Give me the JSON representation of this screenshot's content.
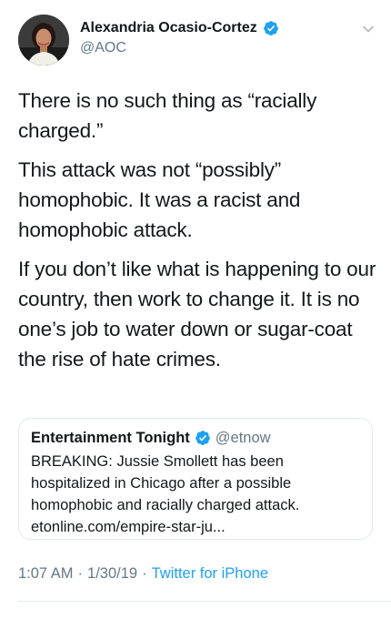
{
  "author": {
    "display_name": "Alexandria Ocasio-Cortez",
    "handle": "@AOC",
    "verified_icon": "verified-badge-icon"
  },
  "menu_icon": "chevron-down-icon",
  "tweet": {
    "paragraphs": [
      "There is no such thing as “racially charged.”",
      "This attack was not “possibly” homophobic. It was a racist and homophobic attack.",
      "If you don’t like what is happening to our country, then work to change it. It is no one’s job to water down or sugar-coat the rise of hate crimes."
    ]
  },
  "quoted_tweet": {
    "display_name": "Entertainment Tonight",
    "handle": "@etnow",
    "text": "BREAKING: Jussie Smollett has been hospitalized in Chicago after a possible homophobic and racially charged attack. etonline.com/empire-star-ju..."
  },
  "meta": {
    "time": "1:07 AM",
    "separator": "·",
    "date": "1/30/19",
    "source": "Twitter for iPhone"
  },
  "colors": {
    "link_blue": "#1da1f2",
    "secondary_text": "#657786",
    "border": "#e1e8ed"
  }
}
